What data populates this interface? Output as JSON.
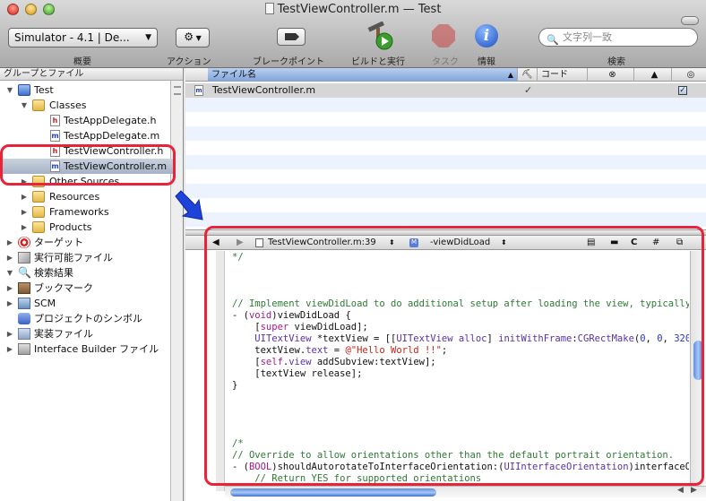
{
  "window": {
    "title": "TestViewController.m — Test",
    "colors": {
      "accent": "#2563d4",
      "highlight": "#e8233a",
      "arrow": "#1f42d8"
    }
  },
  "toolbar": {
    "scheme_value": "Simulator - 4.1 | De...",
    "labels": {
      "overview": "概要",
      "action": "アクション",
      "breakpoints": "ブレークポイント",
      "build_run": "ビルドと実行",
      "tasks": "タスク",
      "info": "情報",
      "search": "検索"
    },
    "search_placeholder": "文字列一致",
    "action_icon": "gear-icon"
  },
  "sidebar": {
    "header": "グループとファイル",
    "items": [
      {
        "label": "Test",
        "icon": "proj"
      },
      {
        "label": "Classes",
        "icon": "folder"
      },
      {
        "label": "TestAppDelegate.h",
        "icon": "hfile"
      },
      {
        "label": "TestAppDelegate.m",
        "icon": "mfile"
      },
      {
        "label": "TestViewController.h",
        "icon": "hfile"
      },
      {
        "label": "TestViewController.m",
        "icon": "mfile"
      },
      {
        "label": "Other Sources",
        "icon": "folder"
      },
      {
        "label": "Resources",
        "icon": "folder"
      },
      {
        "label": "Frameworks",
        "icon": "folder"
      },
      {
        "label": "Products",
        "icon": "folder"
      },
      {
        "label": "ターゲット",
        "icon": "target"
      },
      {
        "label": "実行可能ファイル",
        "icon": "exe"
      },
      {
        "label": "検索結果",
        "icon": "mag"
      },
      {
        "label": "ブックマーク",
        "icon": "book"
      },
      {
        "label": "SCM",
        "icon": "scm"
      },
      {
        "label": "プロジェクトのシンボル",
        "icon": "sym"
      },
      {
        "label": "実装ファイル",
        "icon": "impl"
      },
      {
        "label": "Interface Builder ファイル",
        "icon": "ib"
      }
    ]
  },
  "filelist": {
    "columns": {
      "name": "ファイル名",
      "code": "コード"
    },
    "rows": [
      {
        "name": "TestViewController.m",
        "checked": "✓"
      }
    ]
  },
  "editor": {
    "nav_file": "TestViewController.m:39",
    "nav_method": "-viewDidLoad",
    "nav_lang": "C",
    "nav_hash": "#"
  }
}
